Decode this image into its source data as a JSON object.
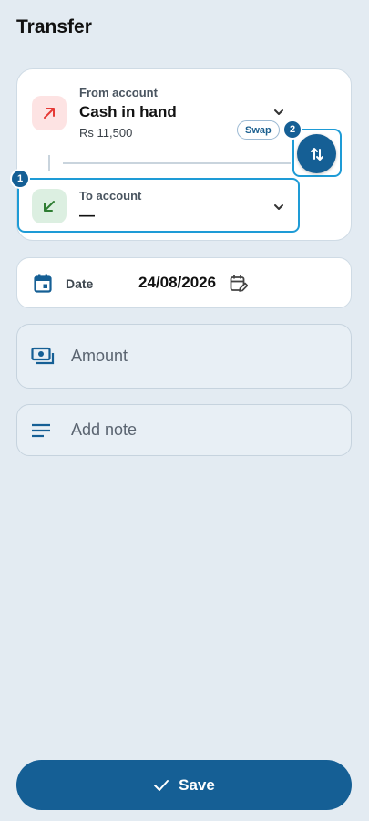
{
  "page": {
    "title": "Transfer"
  },
  "from_account": {
    "label": "From account",
    "name": "Cash in hand",
    "balance": "Rs 11,500",
    "icon": "arrow-up-right-icon",
    "icon_color": "#e53935"
  },
  "to_account": {
    "label": "To account",
    "name": "—",
    "icon": "arrow-down-left-icon",
    "icon_color": "#2e7d32"
  },
  "swap": {
    "chip_label": "Swap",
    "icon": "swap-vertical-icon"
  },
  "steps": [
    "1",
    "2"
  ],
  "date": {
    "label": "Date",
    "value": "24/08/2026",
    "icon": "calendar-icon",
    "edit_icon": "calendar-edit-icon"
  },
  "amount": {
    "placeholder": "Amount",
    "icon": "cash-icon"
  },
  "note": {
    "placeholder": "Add note",
    "icon": "notes-icon"
  },
  "save": {
    "label": "Save",
    "icon": "check-icon"
  },
  "colors": {
    "primary": "#155f95",
    "background": "#e3ebf2",
    "highlight": "#1e9bd6"
  }
}
